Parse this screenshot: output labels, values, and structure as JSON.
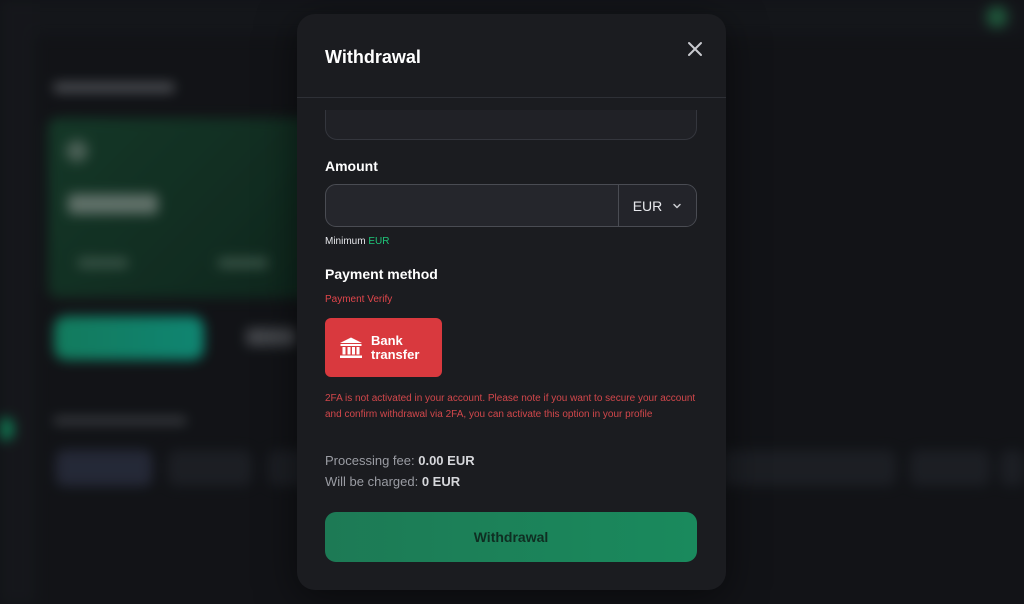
{
  "background": {
    "accent": "#16c784",
    "deposit_gradient": [
      "#19d29b",
      "#13e6c0"
    ]
  },
  "modal": {
    "title": "Withdrawal",
    "close_icon": "close-icon",
    "amount": {
      "label": "Amount",
      "value": "",
      "currency": "EUR",
      "chevron_icon": "chevron-down-icon",
      "minimum_label": "Minimum",
      "minimum_currency": "EUR"
    },
    "payment_method": {
      "label": "Payment method",
      "verify_text": "Payment Verify",
      "bank_transfer_label": "Bank transfer",
      "bank_icon": "bank-icon",
      "color": "#d9393e"
    },
    "twofa_warning": "2FA is not activated in your account. Please note if you want to secure your account and confirm withdrawal via 2FA, you can activate this option in your profile",
    "processing_fee_label": "Processing fee:",
    "processing_fee_value": "0.00 EUR",
    "will_be_charged_label": "Will be charged:",
    "will_be_charged_value": "0 EUR",
    "submit_label": "Withdrawal",
    "submit_color": "#1d7a55"
  }
}
